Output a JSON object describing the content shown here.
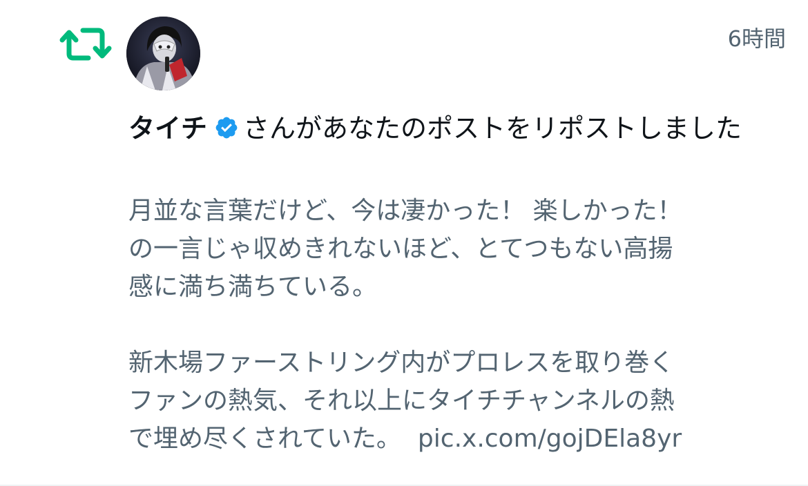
{
  "notification": {
    "timestamp": "6時間",
    "author_name": "タイチ",
    "action_text": "さんがあなたのポストをリポストしました",
    "post_lines": [
      "月並な言葉だけど、今は凄かった！ 楽しかった！",
      "の一言じゃ収めきれないほど、とてつもない高揚",
      "感に満ち満ちている。",
      "新木場ファーストリング内がプロレスを取り巻く",
      "ファンの熱気、それ以上にタイチチャンネルの熱",
      "で埋め尽くされていた。"
    ],
    "pic_link": "pic.x.com/gojDEla8yr",
    "icons": {
      "repost": "repost-icon",
      "verified": "verified-badge-icon",
      "avatar": "avatar"
    },
    "colors": {
      "repost_green": "#00ba7c",
      "verified_blue": "#1d9bf0",
      "secondary_text": "#536471",
      "primary_text": "#0f1419"
    }
  }
}
